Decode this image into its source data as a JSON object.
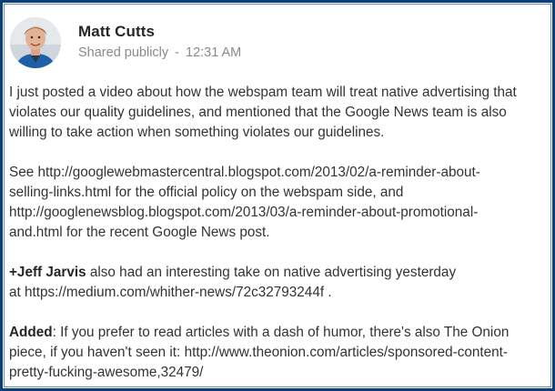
{
  "post": {
    "author": "Matt Cutts",
    "visibility": "Shared publicly",
    "separator": "-",
    "time": "12:31 AM"
  },
  "paragraphs": {
    "p1": {
      "l1": "I just posted a video about how the webspam team will treat native advertising that",
      "l2": "violates our quality guidelines, and mentioned that the Google News team is also",
      "l3": "willing to take action when something violates our guidelines."
    },
    "p2": {
      "l1_pre": "See ",
      "l1_link": "http://googlewebmastercentral.blogspot.com/2013/02/a-reminder-about-",
      "l2_link": "selling-links.html",
      "l2_post": " for the official policy on the webspam side, and",
      "l3_link": "http://googlenewsblog.blogspot.com/2013/03/a-reminder-about-promotional-",
      "l4_link": "and.html",
      "l4_post": " for the recent Google News post."
    },
    "p3": {
      "mention": "+Jeff Jarvis",
      "l1_post": " also had an interesting take on native advertising yesterday",
      "l2_pre": "at ",
      "l2_link": "https://medium.com/whither-news/72c32793244f",
      "l2_post": " ."
    },
    "p4": {
      "bold": "Added",
      "l1_post": ": If you prefer to read articles with a dash of humor, there's also The Onion",
      "l2_pre": "piece, if you haven't seen it: ",
      "l2_link": "http://www.theonion.com/articles/sponsored-content-",
      "l3_link": "pretty-fucking-awesome,32479/"
    }
  },
  "colors": {
    "frame": "#0b3f7a",
    "name": "#262626",
    "meta": "#8a8a8a",
    "text": "#333333"
  },
  "icons": {
    "avatar": "profile-photo"
  }
}
